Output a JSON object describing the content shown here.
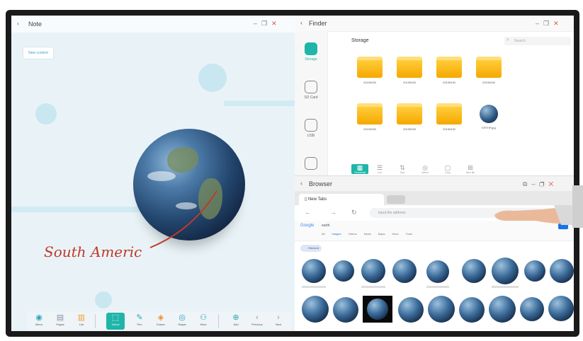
{
  "note": {
    "title": "Note",
    "back_icon": "chevron-left",
    "new_content_label": "New content",
    "annotation_text": "South Americ",
    "annotation_color": "#c0392b",
    "toolbar": [
      {
        "name": "menu",
        "label": "Menu",
        "icon": "circle-icon"
      },
      {
        "name": "pages",
        "label": "Pages",
        "icon": "pages-icon"
      },
      {
        "name": "list",
        "label": "List",
        "icon": "list-icon"
      },
      {
        "name": "select",
        "label": "Select",
        "icon": "select-icon",
        "active": true
      },
      {
        "name": "pen",
        "label": "Pen",
        "icon": "pen-icon"
      },
      {
        "name": "eraser",
        "label": "Eraser",
        "icon": "eraser-icon"
      },
      {
        "name": "shape",
        "label": "Shape",
        "icon": "shape-icon"
      },
      {
        "name": "more",
        "label": "More",
        "icon": "more-icon"
      },
      {
        "name": "add",
        "label": "Add",
        "icon": "plus-icon"
      },
      {
        "name": "previous",
        "label": "Previous",
        "icon": "chevron-left-icon"
      },
      {
        "name": "next",
        "label": "Next",
        "icon": "chevron-right-icon"
      }
    ]
  },
  "finder": {
    "title": "Finder",
    "breadcrumb": "Storage",
    "search_placeholder": "Search",
    "sidebar": [
      {
        "label": "Storage",
        "icon": "storage-icon",
        "active": true
      },
      {
        "label": "SD Card",
        "icon": "sd-card-icon"
      },
      {
        "label": "USB",
        "icon": "usb-icon"
      },
      {
        "label": "",
        "icon": "printer-icon"
      }
    ],
    "items": [
      {
        "label": "20190430",
        "type": "folder"
      },
      {
        "label": "20190430",
        "type": "folder"
      },
      {
        "label": "20190430",
        "type": "folder"
      },
      {
        "label": "20190430",
        "type": "folder"
      },
      {
        "label": "20190430",
        "type": "folder"
      },
      {
        "label": "20190430",
        "type": "folder"
      },
      {
        "label": "20190430",
        "type": "folder"
      },
      {
        "label": "ERTHP.jpg",
        "type": "image"
      }
    ],
    "tools": [
      {
        "label": "Thumbnail",
        "icon": "thumbnail-icon",
        "active": true
      },
      {
        "label": "List",
        "icon": "list-icon"
      },
      {
        "label": "Sort",
        "icon": "sort-icon"
      },
      {
        "label": "Select",
        "icon": "select-icon"
      },
      {
        "label": "Copy",
        "icon": "copy-icon"
      },
      {
        "label": "New file",
        "icon": "new-file-icon"
      }
    ]
  },
  "browser": {
    "title": "Browser",
    "tab_label": "New Tabs",
    "address_placeholder": "Input the address",
    "search_engine": "Google",
    "query": "earth",
    "search_tabs": [
      "All",
      "Images",
      "Videos",
      "News",
      "Maps",
      "More",
      "Tools"
    ],
    "active_search_tab": "Images",
    "chip_label": "Element"
  },
  "colors": {
    "accent": "#1fb5a8",
    "folder": "#f5a800",
    "close": "#e05050"
  }
}
